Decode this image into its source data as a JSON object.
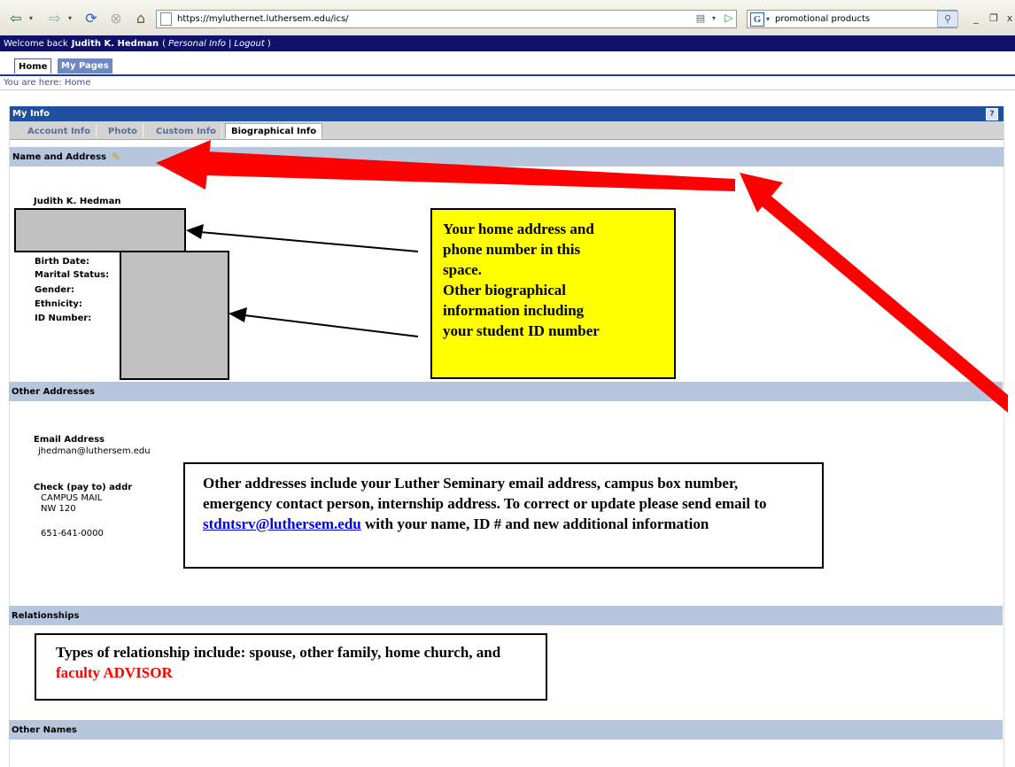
{
  "browser": {
    "url": "https://myluthernet.luthersem.edu/ics/",
    "search_term": "promotional products"
  },
  "header": {
    "welcome_text": "Welcome back",
    "user_name": "Judith K. Hedman",
    "personal_info_link": "Personal Info",
    "separator": "|",
    "logout_link": "Logout"
  },
  "page_tabs": [
    {
      "label": "Home",
      "active": true
    },
    {
      "label": "My Pages",
      "active": false
    }
  ],
  "breadcrumb": "You are here:  Home",
  "panel": {
    "title": "My Info",
    "help_label": "?",
    "tabs": [
      {
        "label": "Account Info",
        "active": false
      },
      {
        "label": "Photo",
        "active": false
      },
      {
        "label": "Custom Info",
        "active": false
      },
      {
        "label": "Biographical Info",
        "active": true
      }
    ]
  },
  "sections": {
    "name_address": {
      "title": "Name and Address",
      "full_name": "Judith K. Hedman",
      "fields": [
        "Birth Date:",
        "Marital Status:",
        "Gender:",
        "Ethnicity:",
        "ID Number:"
      ]
    },
    "other_addresses": {
      "title": "Other Addresses",
      "email_label": "Email Address",
      "email_value": "jhedman@luthersem.edu",
      "check_label": "Check (pay to) addr",
      "check_line1": "CAMPUS MAIL",
      "check_line2": "NW 120",
      "phone": "651-641-0000"
    },
    "relationships": {
      "title": "Relationships"
    },
    "other_names": {
      "title": "Other Names"
    }
  },
  "callouts": {
    "home_address": {
      "line1": "Your home address and",
      "line2": "phone number in this",
      "line3": "space.",
      "line4": "Other biographical",
      "line5": "information including",
      "line6": "your student ID number"
    },
    "other_addresses": {
      "text_before": "Other addresses include your Luther Seminary email address, campus box number, emergency contact person, internship address.  To correct or update please send email to ",
      "email_link": "stdntsrv@luthersem.edu",
      "text_after": " with your name, ID # and new additional information"
    },
    "relationships": {
      "text": "Types of relationship include: spouse, other family, home church, and ",
      "highlight": "faculty ADVISOR"
    }
  },
  "colors": {
    "welcome_bar": "#10106a",
    "panel_header": "#1e4fa0",
    "section_header": "#b6c7dd",
    "callout_yellow": "#ffff00",
    "arrow_red": "#ff0000"
  }
}
